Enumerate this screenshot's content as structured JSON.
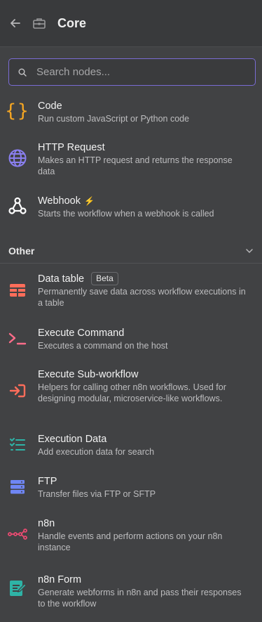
{
  "header": {
    "title": "Core"
  },
  "search": {
    "placeholder": "Search nodes..."
  },
  "core_items": [
    {
      "name": "Code",
      "description": "Run custom JavaScript or Python code",
      "icon": "code-braces-icon"
    },
    {
      "name": "HTTP Request",
      "description": "Makes an HTTP request and returns the response data",
      "icon": "globe-icon"
    },
    {
      "name": "Webhook",
      "description": "Starts the workflow when a webhook is called",
      "icon": "webhook-icon"
    }
  ],
  "section": {
    "label": "Other"
  },
  "other_items": [
    {
      "name": "Data table",
      "badge": "Beta",
      "description": "Permanently save data across workflow executions in a table",
      "icon": "table-icon"
    },
    {
      "name": "Execute Command",
      "description": "Executes a command on the host",
      "icon": "terminal-icon"
    },
    {
      "name": "Execute Sub-workflow",
      "description": "Helpers for calling other n8n workflows. Used for designing modular, microservice-like workflows.",
      "icon": "sign-in-icon"
    },
    {
      "name": "Execution Data",
      "description": "Add execution data for search",
      "icon": "tasks-icon"
    },
    {
      "name": "FTP",
      "description": "Transfer files via FTP or SFTP",
      "icon": "server-icon"
    },
    {
      "name": "n8n",
      "description": "Handle events and perform actions on your n8n instance",
      "icon": "n8n-logo-icon"
    },
    {
      "name": "n8n Form",
      "description": "Generate webforms in n8n and pass their responses to the workflow",
      "icon": "form-icon"
    }
  ],
  "colors": {
    "background": "#414244",
    "accent_code": "#f5a623",
    "accent_http": "#8a7ff0",
    "accent_red": "#ff6d5a",
    "accent_pink": "#ff6d8a",
    "accent_teal": "#2eb3a6",
    "accent_blue": "#6f86f5",
    "accent_n8n": "#ea4b71"
  }
}
